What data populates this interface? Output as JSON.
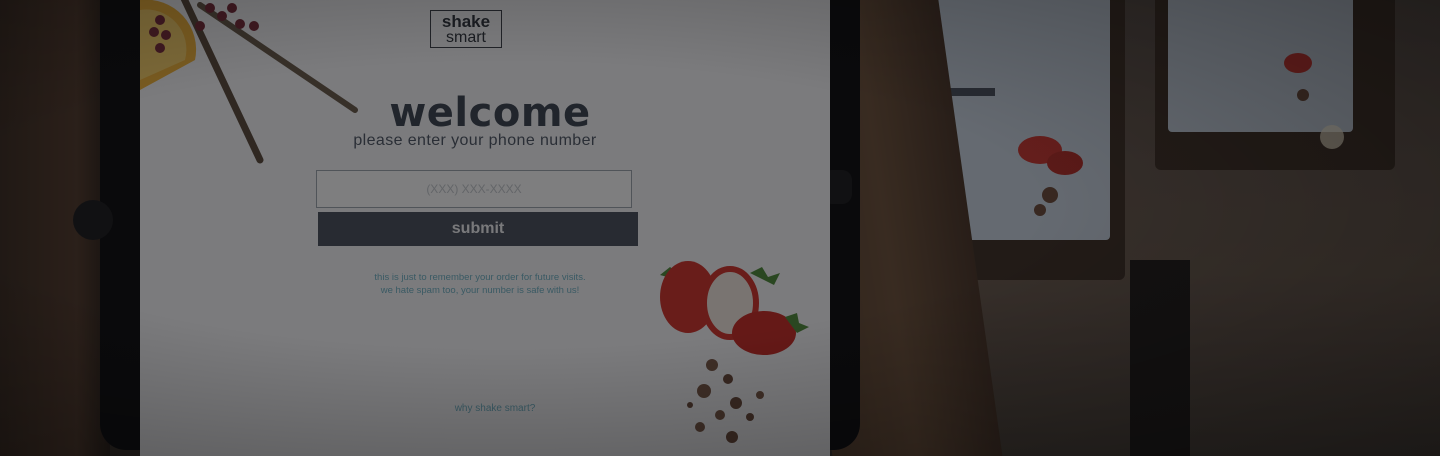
{
  "kiosk": {
    "logo_line1": "shake",
    "logo_line2": "smart",
    "title": "welcome",
    "subtitle": "please enter your phone number",
    "phone_placeholder": "(XXX) XXX-XXXX",
    "submit_label": "submit",
    "note_line1": "this is just to remember your order for future visits.",
    "note_line2": "we hate spam too, your number is safe with us!",
    "why_link": "why shake smart?"
  },
  "colors": {
    "screen_bg": "#f6f7f8",
    "title": "#3b4451",
    "button_bg": "#4a515c",
    "link": "#6fb1c4"
  },
  "icons": [
    "orange-slice-icon",
    "berry-branch-icon",
    "strawberry-icon",
    "chocolate-crumbs-icon"
  ]
}
